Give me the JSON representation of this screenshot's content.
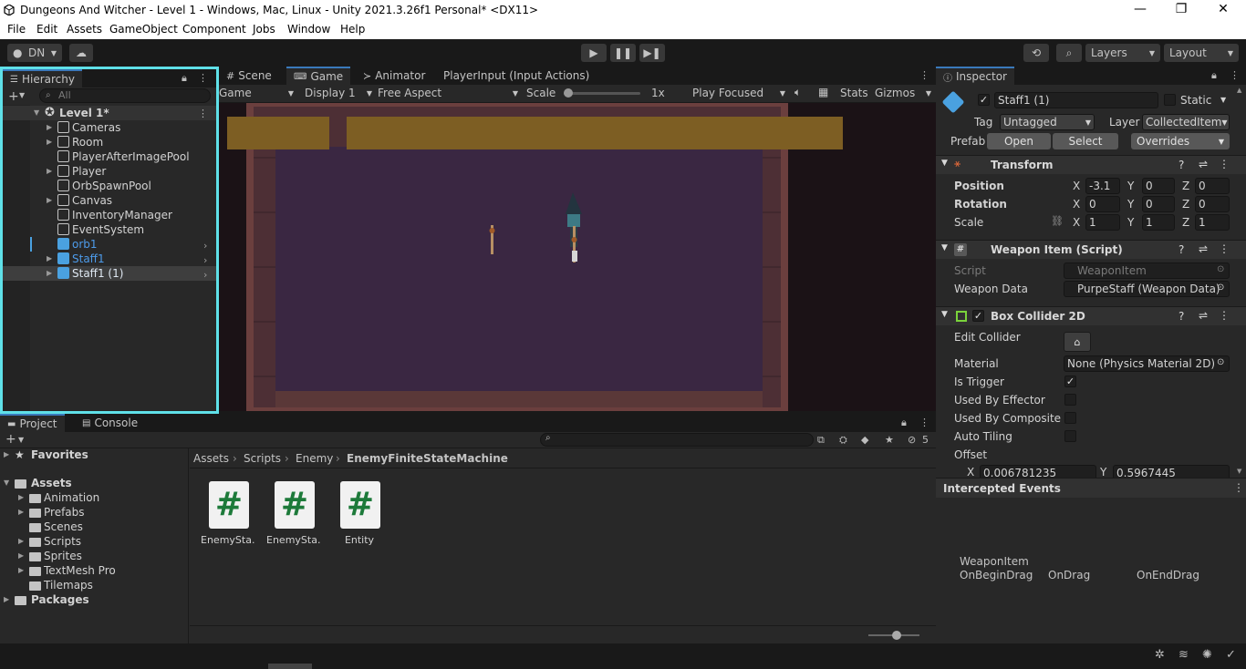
{
  "window": {
    "title": "Dungeons And Witcher - Level 1 - Windows, Mac, Linux - Unity 2021.3.26f1 Personal* <DX11>",
    "minimize": "—",
    "restore": "❐",
    "close": "✕"
  },
  "menu": [
    "File",
    "Edit",
    "Assets",
    "GameObject",
    "Component",
    "Jobs",
    "Window",
    "Help"
  ],
  "toolbar": {
    "account": "DN",
    "layers": "Layers",
    "layout": "Layout"
  },
  "hierarchy": {
    "tab": "Hierarchy",
    "search_placeholder": "All",
    "scene": "Level 1*",
    "items": [
      {
        "label": "Cameras",
        "expandable": true
      },
      {
        "label": "Room",
        "expandable": true
      },
      {
        "label": "PlayerAfterImagePool",
        "expandable": false
      },
      {
        "label": "Player",
        "expandable": true
      },
      {
        "label": "OrbSpawnPool",
        "expandable": false
      },
      {
        "label": "Canvas",
        "expandable": true
      },
      {
        "label": "InventoryManager",
        "expandable": false
      },
      {
        "label": "EventSystem",
        "expandable": false
      },
      {
        "label": "orb1",
        "expandable": false,
        "prefab": true
      },
      {
        "label": "Staff1",
        "expandable": true,
        "prefab": true
      },
      {
        "label": "Staff1 (1)",
        "expandable": true,
        "prefab": true,
        "selected": true
      }
    ]
  },
  "tabs": {
    "scene": "Scene",
    "game": "Game",
    "animator": "Animator",
    "player_input": "PlayerInput (Input Actions)"
  },
  "game_toolbar": {
    "mode": "Game",
    "display": "Display 1",
    "aspect": "Free Aspect",
    "scale_label": "Scale",
    "scale_value": "1x",
    "play_focused": "Play Focused",
    "stats": "Stats",
    "gizmos": "Gizmos"
  },
  "inspector": {
    "tab": "Inspector",
    "object_name": "Staff1 (1)",
    "static_label": "Static",
    "tag_label": "Tag",
    "tag_value": "Untagged",
    "layer_label": "Layer",
    "layer_value": "CollectedItem",
    "prefab_label": "Prefab",
    "open": "Open",
    "select": "Select",
    "overrides": "Overrides",
    "transform": {
      "title": "Transform",
      "position_label": "Position",
      "rotation_label": "Rotation",
      "scale_label": "Scale",
      "pos": {
        "x": "-3.1",
        "y": "0",
        "z": "0"
      },
      "rot": {
        "x": "0",
        "y": "0",
        "z": "0"
      },
      "scale": {
        "x": "1",
        "y": "1",
        "z": "1"
      },
      "x": "X",
      "y": "Y",
      "z": "Z"
    },
    "weapon_item": {
      "title": "Weapon Item (Script)",
      "script_label": "Script",
      "script_value": "WeaponItem",
      "data_label": "Weapon Data",
      "data_value": "PurpeStaff (Weapon Data)"
    },
    "box_collider": {
      "title": "Box Collider 2D",
      "edit_collider": "Edit Collider",
      "material_label": "Material",
      "material_value": "None (Physics Material 2D)",
      "is_trigger": "Is Trigger",
      "used_by_effector": "Used By Effector",
      "used_by_composite": "Used By Composite",
      "auto_tiling": "Auto Tiling",
      "offset": "Offset",
      "offset_x": "0.006781235",
      "offset_y": "0.5967445"
    }
  },
  "events": {
    "title": "Intercepted Events",
    "component": "WeaponItem",
    "on_begin_drag": "OnBeginDrag",
    "on_drag": "OnDrag",
    "on_end_drag": "OnEndDrag"
  },
  "project": {
    "tab_project": "Project",
    "tab_console": "Console",
    "hidden_count": "5",
    "favorites": "Favorites",
    "assets": "Assets",
    "asset_folders": [
      "Animation",
      "Prefabs",
      "Scenes",
      "Scripts",
      "Sprites",
      "TextMesh Pro",
      "Tilemaps"
    ],
    "packages": "Packages",
    "breadcrumb": [
      "Assets",
      "Scripts",
      "Enemy",
      "EnemyFiniteStateMachine"
    ],
    "files": [
      "EnemySta...",
      "EnemySta...",
      "Entity"
    ]
  },
  "colors": {
    "accent": "#3a79bb",
    "hierarchy_highlight": "#5fe0e8",
    "prefab_blue": "#4aa1e0",
    "game_floor": "#3a2742",
    "game_wall": "#8b5a4f",
    "game_banner": "#7d5e23"
  }
}
